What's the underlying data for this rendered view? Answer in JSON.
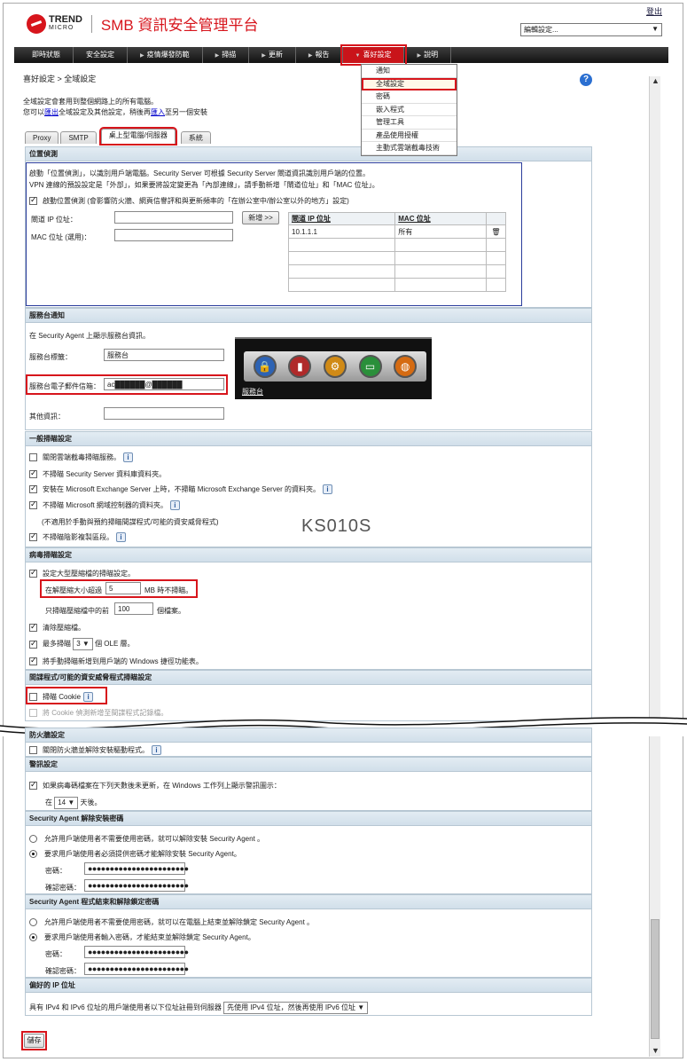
{
  "header": {
    "logo_brand": "TREND",
    "logo_sub": "MICRO",
    "app_title": "SMB 資訊安全管理平台",
    "logout": "登出",
    "edit_select": "編輯設定..."
  },
  "nav": {
    "items": [
      "即時狀態",
      "安全設定",
      "疫情爆發防範",
      "掃描",
      "更新",
      "報告",
      "喜好設定",
      "說明"
    ]
  },
  "dropdown": {
    "items": [
      "通知",
      "全域設定",
      "密碼",
      "嵌入程式",
      "管理工具",
      "產品使用授權",
      "主動式雲端截毒技術"
    ]
  },
  "page": {
    "breadcrumb": "喜好設定 > 全域設定",
    "intro_line1": "全域設定會套用到整個網路上的所有電腦。",
    "intro_line2_pre": "您可以",
    "intro_export": "匯出",
    "intro_line2_mid": "全域設定及其他設定，稍後再",
    "intro_import": "匯入",
    "intro_line2_post": "至另一個安裝"
  },
  "tabs": [
    "Proxy",
    "SMTP",
    "桌上型電腦/伺服器",
    "系統"
  ],
  "location": {
    "title": "位置偵測",
    "desc1": "啟動「位置偵測」，以識別用戶端電腦。Security Server 可根據 Security Server 閘道資訊識別用戶端的位置。",
    "desc2": "VPN 連線的預設設定是「外部」，如果要將設定變更為「內部連線」，請手動新增「閘道位址」和「MAC 位址」。",
    "enable_label": "啟動位置偵測 (會影響防火牆、網頁信譽評和與更新頻率的「在辦公室中/辦公室以外的地方」設定)",
    "gateway_label": "閘道 IP 位址：",
    "mac_label": "MAC 位址 (選用)：",
    "add_button": "新增 >>",
    "col_ip": "閘道 IP 位址",
    "col_mac": "MAC 位址",
    "row_ip": "10.1.1.1",
    "row_mac": "所有"
  },
  "helpdesk": {
    "title": "服務台通知",
    "desc": "在 Security Agent 上顯示服務台資訊。",
    "label_label": "服務台標籤：",
    "label_value": "服務台",
    "email_label": "服務台電子郵件信箱：",
    "email_value": "ac██████@██████",
    "other_label": "其他資訊：",
    "preview_label": "服務台"
  },
  "general_scan": {
    "title": "一般掃瞄設定",
    "opt1": "關閉雲端截毒掃瞄服務。",
    "opt2": "不掃瞄 Security Server 資料庫資料夾。",
    "opt3": "安裝在 Microsoft Exchange Server 上時，不掃瞄 Microsoft Exchange Server 的資料夾。",
    "opt4": "不掃瞄 Microsoft 網域控制器的資料夾。",
    "note": "(不適用於手動與預約掃瞄間諜程式/可能的資安威脅程式)",
    "opt5": "不掃瞄陰影複製區段。"
  },
  "watermark": "KS010S",
  "virus_scan": {
    "title": "病毒掃瞄設定",
    "opt1": "設定大型壓縮檔的掃瞄設定。",
    "size_pre": "在解壓縮大小超過",
    "size_value": "5",
    "size_post": "MB 時不掃瞄。",
    "first_pre": "只掃瞄壓縮檔中的前",
    "first_value": "100",
    "first_post": "個檔案。",
    "opt2": "清除壓縮檔。",
    "ole_pre": "最多掃瞄",
    "ole_value": "3",
    "ole_post": "個 OLE 層。",
    "opt4": "將手動掃瞄新增到用戶端的 Windows 捷徑功能表。"
  },
  "spyware": {
    "title": "間諜程式/可能的資安威脅程式掃瞄設定",
    "opt1": "掃瞄 Cookie",
    "opt2": "將 Cookie 偵測新增至間諜程式記錄檔。"
  },
  "firewall": {
    "title": "防火牆設定",
    "opt1": "關閉防火牆並解除安裝驅動程式。"
  },
  "alert": {
    "title": "警訊設定",
    "opt1": "如果病毒碼檔案在下列天數後未更新，在 Windows 工作列上顯示警訊圖示：",
    "days_pre": "在",
    "days_value": "14",
    "days_post": "天後。"
  },
  "uninstall_pw": {
    "title": "Security Agent 解除安裝密碼",
    "opt1": "允許用戶端使用者不需要使用密碼，就可以解除安裝 Security Agent 。",
    "opt2": "要求用戶端使用者必須提供密碼才能解除安裝 Security Agent。",
    "pw_label": "密碼：",
    "confirm_label": "確認密碼：",
    "pw_mask": "●●●●●●●●●●●●●●●●●●●●●●●"
  },
  "unload_pw": {
    "title": "Security Agent 程式結束和解除鎖定密碼",
    "opt1": "允許用戶端使用者不需要使用密碼，就可以在電腦上結束並解除鎖定 Security Agent 。",
    "opt2": "要求用戶端使用者輸入密碼，才能結束並解除鎖定 Security Agent。",
    "pw_label": "密碼：",
    "confirm_label": "確認密碼：",
    "pw_mask": "●●●●●●●●●●●●●●●●●●●●●●●"
  },
  "ip_pref": {
    "title": "偏好的 IP 位址",
    "label": "具有 IPv4 和 IPv6 位址的用戶端使用者以下位址註冊到伺服器",
    "value": "先使用 IPv4 位址，然後再使用 IPv6 位址"
  },
  "save_button": "儲存"
}
